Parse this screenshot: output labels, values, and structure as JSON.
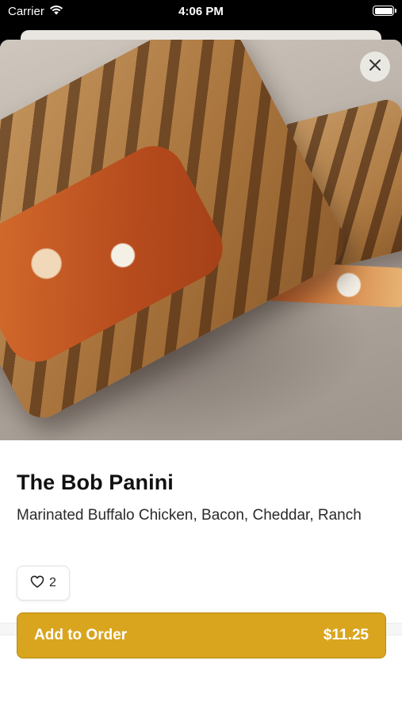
{
  "status_bar": {
    "carrier": "Carrier",
    "time": "4:06 PM"
  },
  "item": {
    "title": "The Bob Panini",
    "description": "Marinated Buffalo Chicken, Bacon, Cheddar, Ranch",
    "like_count": "2",
    "image_icon": "panini-photo"
  },
  "actions": {
    "close_icon": "close-icon",
    "add_to_order_label": "Add to Order",
    "price": "$11.25"
  },
  "colors": {
    "accent": "#d9a51e",
    "accent_border": "#b98a12",
    "text_primary": "#111111"
  }
}
